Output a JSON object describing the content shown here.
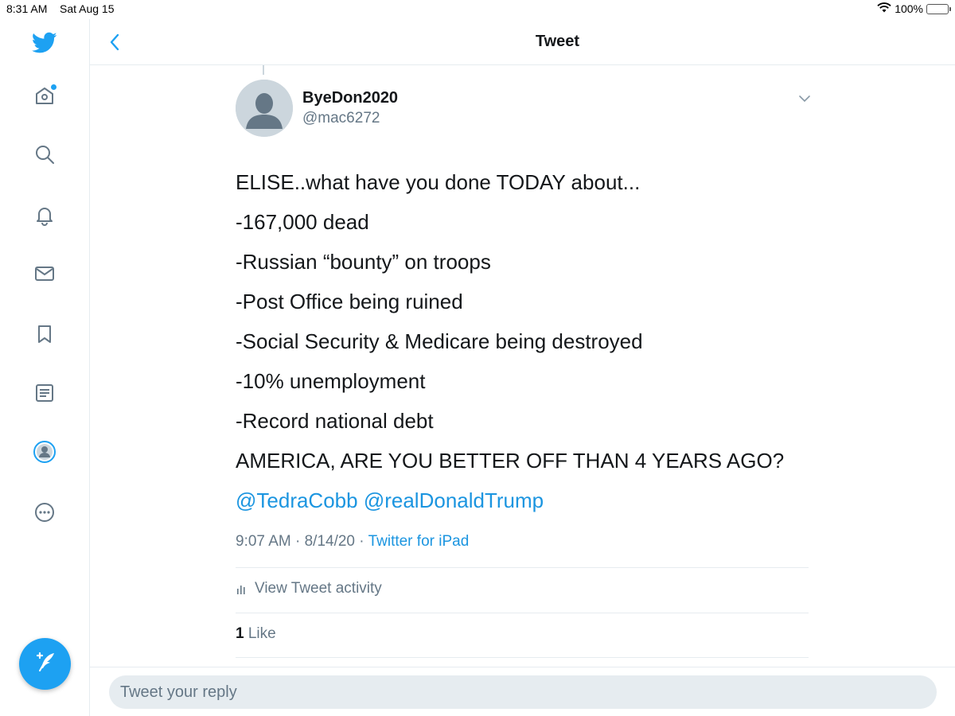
{
  "status_bar": {
    "time": "8:31 AM",
    "date": "Sat Aug 15",
    "battery": "100%"
  },
  "sidebar": {
    "items": [
      {
        "icon": "twitter-logo-icon"
      },
      {
        "icon": "home-icon"
      },
      {
        "icon": "search-icon"
      },
      {
        "icon": "bell-icon"
      },
      {
        "icon": "mail-icon"
      },
      {
        "icon": "bookmark-icon"
      },
      {
        "icon": "list-icon"
      },
      {
        "icon": "profile-icon"
      },
      {
        "icon": "more-icon"
      }
    ],
    "compose_icon": "compose-tweet-icon"
  },
  "header": {
    "title": "Tweet"
  },
  "tweet": {
    "display_name": "ByeDon2020",
    "handle": "@mac6272",
    "lines": [
      "ELISE..what have you done TODAY about...",
      "-167,000 dead",
      "-Russian “bounty” on troops",
      "-Post Office being ruined",
      "-Social Security & Medicare being destroyed",
      "-10% unemployment",
      "-Record national debt",
      "AMERICA, ARE YOU BETTER OFF THAN 4 YEARS AGO?"
    ],
    "mentions": [
      "@TedraCobb",
      "@realDonaldTrump"
    ],
    "time": "9:07 AM",
    "date": "8/14/20",
    "source": "Twitter for iPad",
    "activity_label": "View Tweet activity",
    "like_count": "1",
    "like_label": "Like"
  },
  "reply": {
    "placeholder": "Tweet your reply"
  },
  "colors": {
    "accent": "#1da1f2",
    "link": "#1b95e0",
    "muted": "#657786",
    "divider": "#e6ecf0"
  }
}
